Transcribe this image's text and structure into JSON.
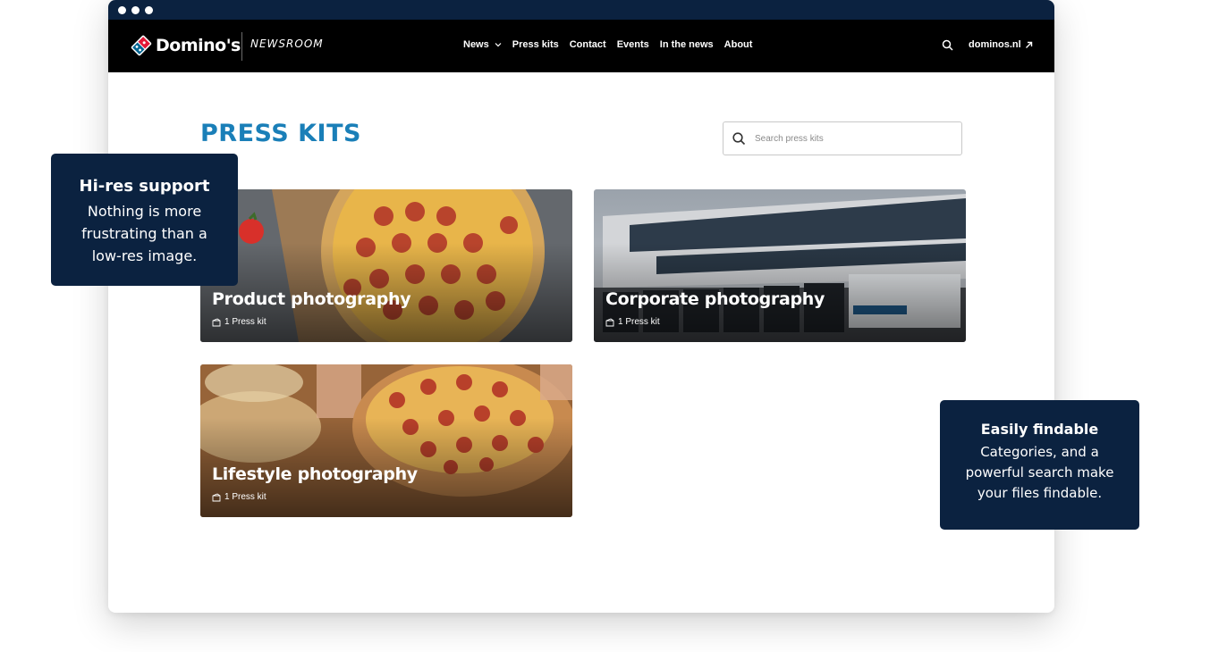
{
  "colors": {
    "chrome": "#0b2240",
    "navbar": "#000000",
    "title": "#1a7fb8",
    "callout_bg": "#0b2240",
    "logo_red": "#e31837",
    "logo_blue": "#006491"
  },
  "navbar": {
    "brand": "Domino's",
    "section": "NEWSROOM",
    "items": [
      {
        "label": "News",
        "has_dropdown": true
      },
      {
        "label": "Press kits"
      },
      {
        "label": "Contact"
      },
      {
        "label": "Events"
      },
      {
        "label": "In the news"
      },
      {
        "label": "About"
      }
    ],
    "search_icon": "search-icon",
    "external_link": "dominos.nl"
  },
  "main": {
    "title": "PRESS KITS",
    "search": {
      "placeholder": "Search press kits",
      "value": ""
    },
    "cards": [
      {
        "title": "Product photography",
        "meta": "1 Press kit",
        "image": "pizza-pepperoni-photo"
      },
      {
        "title": "Corporate photography",
        "meta": "1 Press kit",
        "image": "building-trucks-photo"
      },
      {
        "title": "Lifestyle photography",
        "meta": "1 Press kit",
        "image": "pizza-hands-photo"
      }
    ]
  },
  "callouts": [
    {
      "title": "Hi-res support",
      "lines": [
        "Nothing is more",
        "frustrating than a",
        "low-res image."
      ]
    },
    {
      "title": "Easily findable",
      "lines": [
        "Categories, and a",
        "powerful search make",
        "your files findable."
      ]
    }
  ]
}
